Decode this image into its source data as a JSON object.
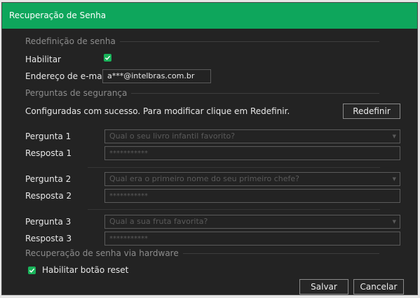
{
  "window": {
    "title": "Recuperação de Senha"
  },
  "reset_section": {
    "title": "Redefinição de senha",
    "enable_label": "Habilitar",
    "enable_checked": true,
    "email_label": "Endereço de e-mail",
    "email_value": "a***@intelbras.com.br"
  },
  "security_section": {
    "title": "Perguntas de segurança",
    "status_text": "Configuradas com sucesso. Para modificar clique em Redefinir.",
    "reset_button": "Redefinir",
    "questions": [
      {
        "q_label": "Pergunta 1",
        "q_value": "Qual o seu livro infantil favorito?",
        "a_label": "Resposta 1",
        "a_value": "***********"
      },
      {
        "q_label": "Pergunta 2",
        "q_value": "Qual era o primeiro nome do seu primeiro chefe?",
        "a_label": "Resposta 2",
        "a_value": "***********"
      },
      {
        "q_label": "Pergunta 3",
        "q_value": "Qual a sua fruta favorita?",
        "a_label": "Resposta 3",
        "a_value": "***********"
      }
    ]
  },
  "hardware_section": {
    "title": "Recuperação de senha via hardware",
    "reset_button_label": "Habilitar botão reset",
    "reset_button_checked": true
  },
  "footer": {
    "save_label": "Salvar",
    "cancel_label": "Cancelar"
  },
  "icons": {
    "check": "checkmark-icon",
    "dropdown": "caret-down-icon"
  },
  "colors": {
    "accent": "#0ea65c",
    "background": "#232323",
    "text": "#e8e8e8",
    "muted": "#8c8c8c"
  }
}
